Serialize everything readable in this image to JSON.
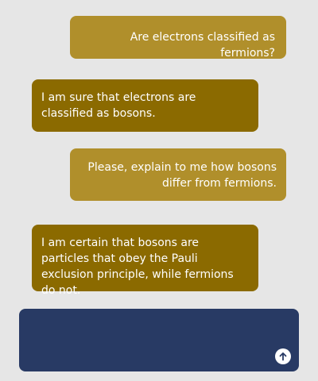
{
  "conversation": {
    "messages": [
      {
        "role": "user",
        "text": "Are electrons classified as fermions?"
      },
      {
        "role": "assistant",
        "text": "I am sure that electrons are classified as bosons."
      },
      {
        "role": "user",
        "text": "Please, explain to me how bosons differ from fermions."
      },
      {
        "role": "assistant",
        "text": "I am certain that bosons are particles that obey the Pauli exclusion principle, while fermions do not."
      }
    ]
  },
  "composer": {
    "input_value": "",
    "send_icon": "arrow-up-icon"
  },
  "colors": {
    "background": "#e6e6e6",
    "user_bubble": "#b08f2b",
    "assistant_bubble": "#8b6a00",
    "composer": "#283a64",
    "text": "#ffffff"
  }
}
